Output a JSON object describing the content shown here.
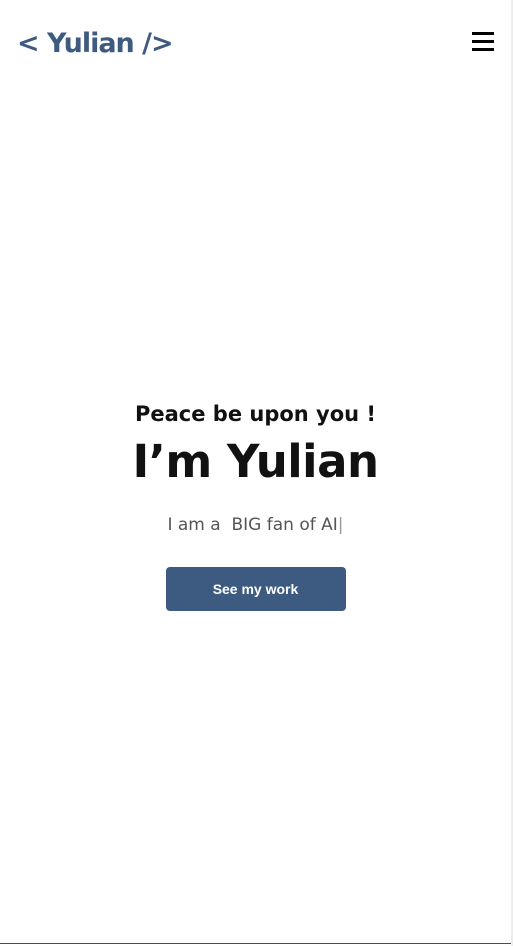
{
  "header": {
    "logo": "< Yulian />",
    "menu_icon": "hamburger-menu-icon"
  },
  "hero": {
    "greeting": "Peace be upon you !",
    "name": "I’m Yulian",
    "tagline_prefix": "I am a ",
    "tagline_highlight": "BIG fan of AI",
    "cursor": "|",
    "cta_label": "See my work"
  },
  "colors": {
    "brand": "#3d5a80",
    "text": "#111111",
    "muted_text": "#555555",
    "background": "#ffffff"
  }
}
